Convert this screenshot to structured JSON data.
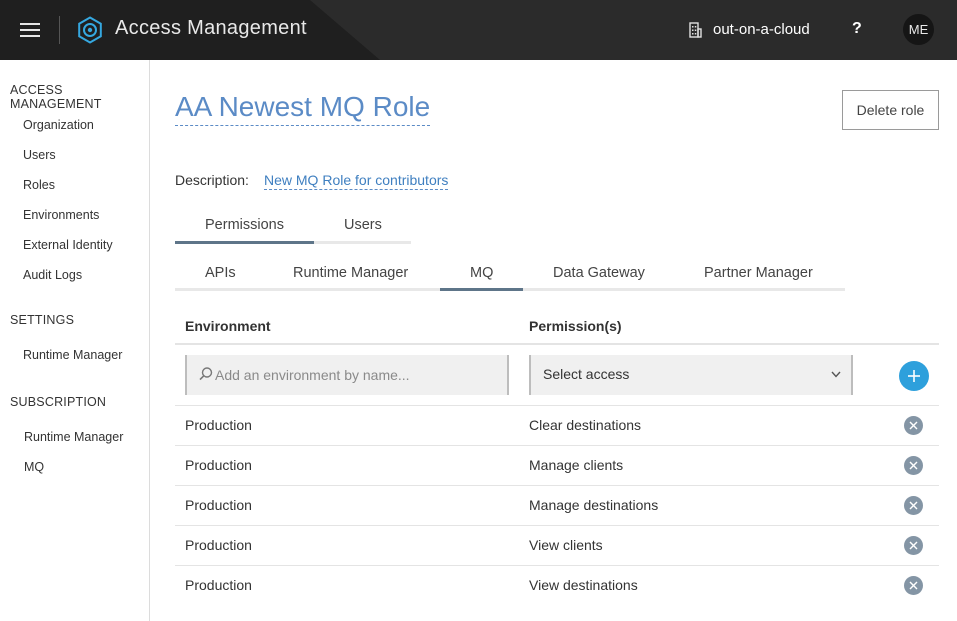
{
  "header": {
    "app_title": "Access Management",
    "org_name": "out-on-a-cloud",
    "help_label": "?",
    "avatar_initials": "ME"
  },
  "sidebar": {
    "sections": [
      {
        "title": "ACCESS MANAGEMENT",
        "items": [
          "Organization",
          "Users",
          "Roles",
          "Environments",
          "External Identity",
          "Audit Logs"
        ]
      },
      {
        "title": "SETTINGS",
        "items": [
          "Runtime Manager"
        ]
      },
      {
        "title": "SUBSCRIPTION",
        "items": [
          "Runtime Manager",
          "MQ"
        ]
      }
    ]
  },
  "role": {
    "title": "AA Newest MQ Role",
    "delete_label": "Delete role",
    "description_label": "Description:",
    "description_value": "New MQ Role for contributors"
  },
  "tabs": {
    "primary": [
      "Permissions",
      "Users"
    ],
    "primary_active": "Permissions",
    "secondary": [
      "APIs",
      "Runtime Manager",
      "MQ",
      "Data Gateway",
      "Partner Manager"
    ],
    "secondary_active": "MQ"
  },
  "table": {
    "headers": [
      "Environment",
      "Permission(s)"
    ],
    "env_placeholder": "Add an environment by name...",
    "access_select_value": "Select access",
    "rows": [
      {
        "environment": "Production",
        "permission": "Clear destinations"
      },
      {
        "environment": "Production",
        "permission": "Manage clients"
      },
      {
        "environment": "Production",
        "permission": "Manage destinations"
      },
      {
        "environment": "Production",
        "permission": "View clients"
      },
      {
        "environment": "Production",
        "permission": "View destinations"
      }
    ]
  },
  "colors": {
    "header_bg": "#2b2b2b",
    "link_blue": "#5b8bc6",
    "add_button": "#2ea0dc",
    "remove_button": "#8495a5",
    "tab_underline": "#5e7589"
  },
  "icons": {
    "menu": "hamburger-icon",
    "logo": "gear-logo-icon",
    "org": "building-icon",
    "search": "search-icon",
    "dropdown": "chevron-down-icon",
    "add": "plus-icon",
    "remove": "close-icon"
  }
}
